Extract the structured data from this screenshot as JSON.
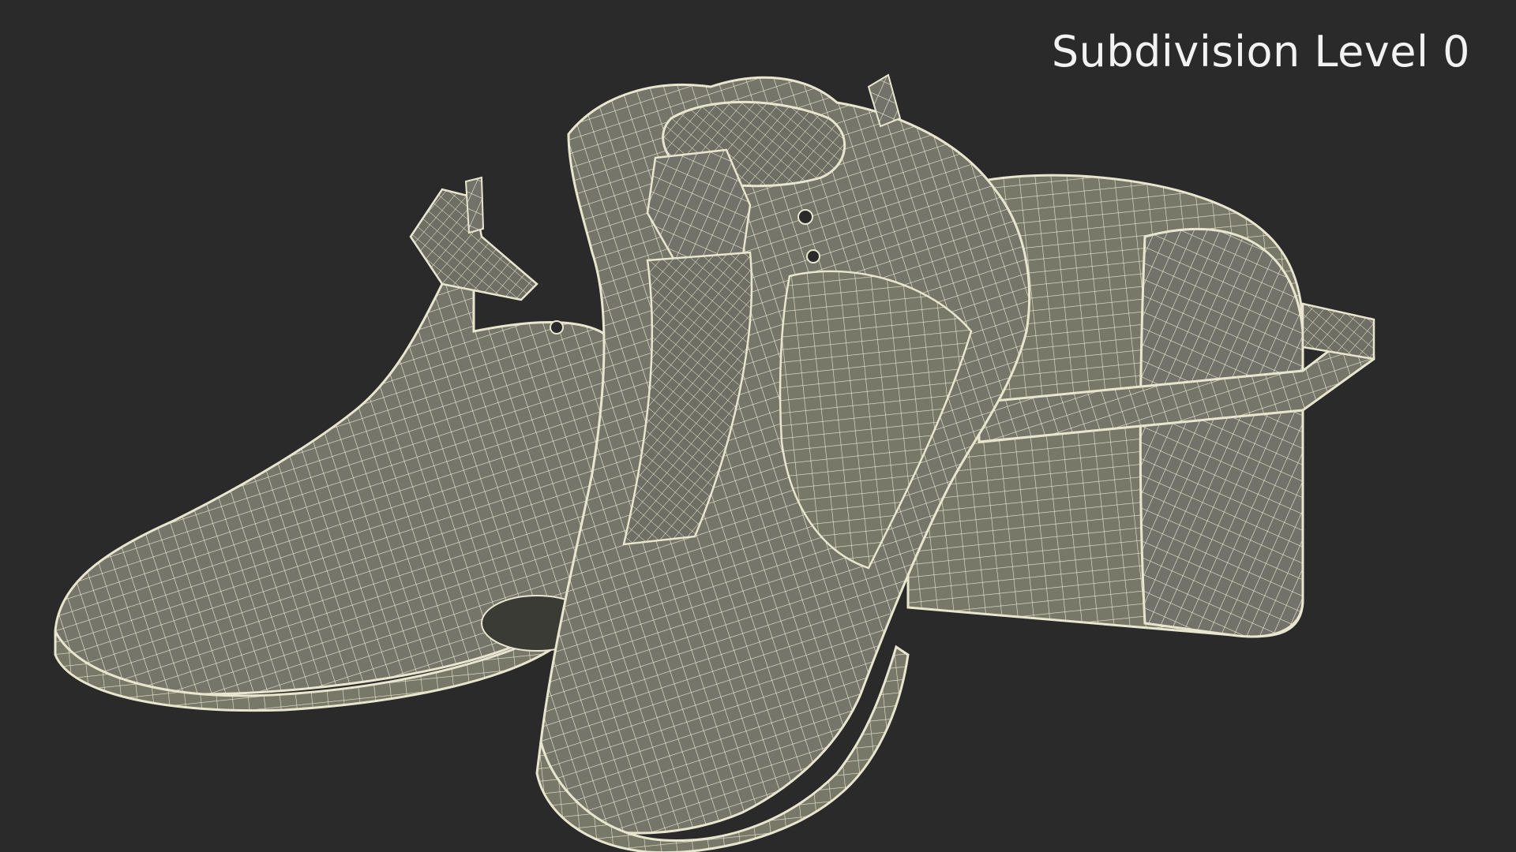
{
  "viewport": {
    "caption": "Subdivision Level 0",
    "background_color": "#2a2a2a",
    "mesh_fill_color": "#75756a",
    "wire_color": "#e9e6cf"
  },
  "scene": {
    "objects": [
      "shoe-left",
      "shoe-right",
      "shoe-box"
    ]
  }
}
